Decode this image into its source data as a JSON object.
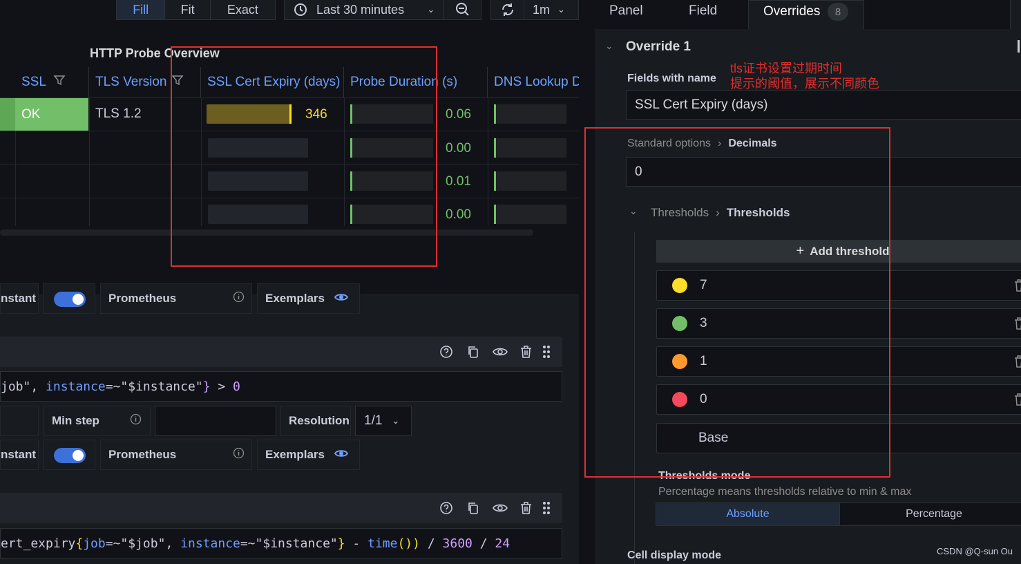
{
  "toolbar": {
    "fill": "Fill",
    "fit": "Fit",
    "exact": "Exact",
    "time_range": "Last 30 minutes",
    "refresh_interval": "1m"
  },
  "panel": {
    "title": "HTTP Probe Overview",
    "columns": [
      "SSL",
      "TLS Version",
      "SSL Cert Expiry (days)",
      "Probe Duration (s)",
      "DNS Lookup D"
    ],
    "row1": {
      "ssl": "OK",
      "tls": "TLS 1.2",
      "expiry": "346"
    },
    "durations": [
      "0.06",
      "0.00",
      "0.01",
      "0.00"
    ]
  },
  "queries": {
    "q1_instant": "nstant",
    "q1_datasource": "Prometheus",
    "q1_exemplars": "Exemplars",
    "q2_code_a": "job\", ",
    "q2_code_b": "instance",
    "q2_code_c": "=~",
    "q2_code_d": "\"$instance\"",
    "q2_code_e": "} > 0",
    "q2_code_brace": "}",
    "q2_code_op": " > ",
    "q2_code_zero": "0",
    "min_step": "Min step",
    "resolution": "Resolution",
    "resolution_value": "1/1",
    "q2_instant": "nstant",
    "q2_datasource": "Prometheus",
    "q2_exemplars": "Exemplars",
    "q3_code_a": "ert_expiry",
    "q3_code_b": "{",
    "q3_code_c": "job",
    "q3_code_d": "=~",
    "q3_code_e": "\"$job\"",
    "q3_code_f": ", ",
    "q3_code_g": "instance",
    "q3_code_h": "=~",
    "q3_code_i": "\"$instance\"",
    "q3_code_j": "}",
    "q3_code_k": " - ",
    "q3_code_l": "time",
    "q3_code_m": "()",
    "q3_code_n": ")",
    "q3_code_o": " / ",
    "q3_code_p": "3600",
    "q3_code_q": " / ",
    "q3_code_r": "24"
  },
  "right": {
    "tabs": {
      "panel": "Panel",
      "field": "Field",
      "overrides": "Overrides",
      "overrides_count": "8"
    },
    "override_title": "Override 1",
    "fields_with_name": "Fields with name",
    "annotation_line1": "tls证书设置过期时间",
    "annotation_line2": "提示的阈值，展示不同颜色",
    "field_value": "SSL Cert Expiry (days)",
    "standard_options": "Standard options",
    "decimals": "Decimals",
    "decimals_value": "0",
    "thresholds_group": "Thresholds",
    "thresholds_label": "Thresholds",
    "add_threshold": "Add threshold",
    "thresholds": [
      {
        "value": "7",
        "color": "#fade2a"
      },
      {
        "value": "3",
        "color": "#73bf69"
      },
      {
        "value": "1",
        "color": "#ff9830"
      },
      {
        "value": "0",
        "color": "#f2495c"
      }
    ],
    "base": "Base",
    "thresholds_mode": "Thresholds mode",
    "thresholds_mode_desc": "Percentage means thresholds relative to min & max",
    "mode_absolute": "Absolute",
    "mode_percentage": "Percentage",
    "cell_display_mode": "Cell display mode",
    "watermark": "CSDN @Q-sun Ou"
  }
}
